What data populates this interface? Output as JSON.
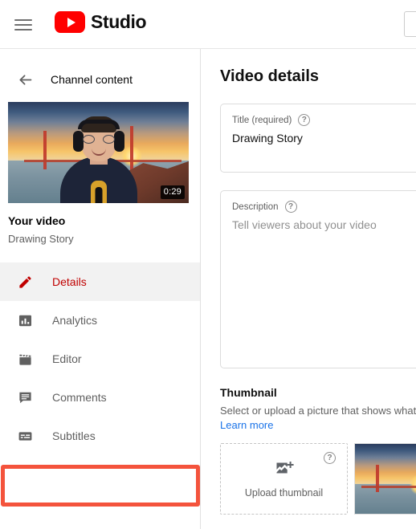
{
  "header": {
    "menu_icon": "hamburger-menu-icon",
    "logo_icon": "youtube-play-logo-icon",
    "brand": "Studio",
    "search_placeholder": ""
  },
  "sidebar": {
    "back_icon": "back-arrow-icon",
    "heading": "Channel content",
    "video": {
      "thumbnail_icon": "video-thumbnail-golden-gate",
      "duration": "0:29",
      "title": "Your video",
      "subtitle": "Drawing Story"
    },
    "nav": [
      {
        "label": "Details",
        "icon": "pencil-icon",
        "active": true
      },
      {
        "label": "Analytics",
        "icon": "bar-chart-icon",
        "active": false
      },
      {
        "label": "Editor",
        "icon": "clapperboard-icon",
        "active": false
      },
      {
        "label": "Comments",
        "icon": "comment-icon",
        "active": false
      },
      {
        "label": "Subtitles",
        "icon": "subtitles-icon",
        "active": false
      }
    ],
    "annotation": {
      "target": "Subtitles",
      "color": "#f4533c"
    }
  },
  "main": {
    "page_title": "Video details",
    "title_field": {
      "label": "Title (required)",
      "help_icon": "help-circle-icon",
      "value": "Drawing Story"
    },
    "description_field": {
      "label": "Description",
      "help_icon": "help-circle-icon",
      "placeholder": "Tell viewers about your video",
      "value": ""
    },
    "thumbnail_section": {
      "title": "Thumbnail",
      "description": "Select or upload a picture that shows what",
      "link": "Learn more",
      "upload": {
        "label": "Upload thumbnail",
        "icon": "add-image-icon",
        "help_icon": "help-circle-icon"
      },
      "existing_thumbnail_icon": "video-thumbnail-golden-gate"
    }
  },
  "colors": {
    "brand_red": "#ff0000",
    "active_red": "#c00000",
    "link_blue": "#1a73e8",
    "annotation": "#f4533c"
  }
}
